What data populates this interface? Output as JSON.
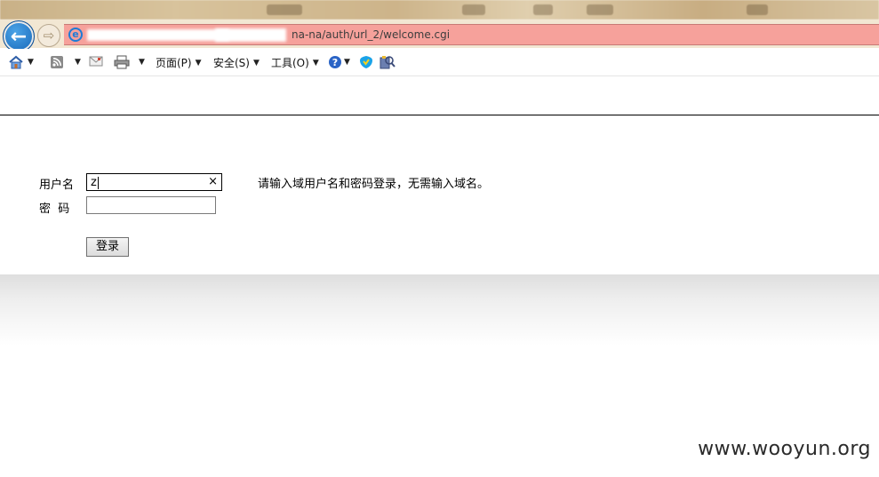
{
  "browser": {
    "address_url": "na-na/auth/url_2/welcome.cgi",
    "toolbar": {
      "page_label": "页面(P)",
      "safety_label": "安全(S)",
      "tools_label": "工具(O)"
    }
  },
  "login": {
    "username_label": "用户名",
    "password_label": "密  码",
    "username_value": "z",
    "password_value": "",
    "clear_symbol": "×",
    "hint": "请输入域用户名和密码登录，无需输入域名。",
    "submit_label": "登录"
  },
  "watermark": "www.wooyun.org",
  "icons": [
    "back-arrow-icon",
    "forward-arrow-icon",
    "ie-logo-icon",
    "home-icon",
    "rss-feed-icon",
    "mail-icon",
    "print-icon",
    "help-icon",
    "ie-shield-icon",
    "research-icon",
    "dropdown-caret-icon",
    "clear-field-icon"
  ]
}
